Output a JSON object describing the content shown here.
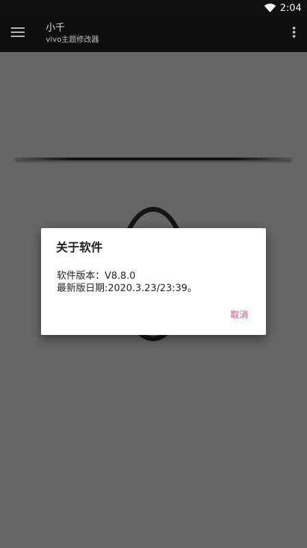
{
  "status_bar": {
    "time": "2:04",
    "wifi_icon": "wifi-icon"
  },
  "app_bar": {
    "menu_icon": "menu-icon",
    "title": "小千",
    "subtitle": "vivo主题修改器",
    "overflow_icon": "more-vert-icon"
  },
  "dialog": {
    "title": "关于软件",
    "version_line": "软件版本：V8.8.0",
    "date_line": "最新版日期:2020.3.23/23:39。",
    "cancel_label": "取消"
  },
  "colors": {
    "accent": "#e0437b",
    "background": "#666666",
    "app_bar": "#0f0f0f"
  }
}
